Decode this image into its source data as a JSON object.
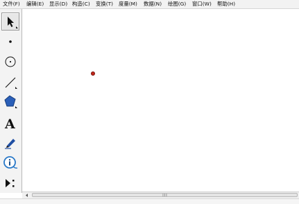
{
  "menubar": {
    "items": [
      {
        "label": "文件(F)"
      },
      {
        "label": "编辑(E)"
      },
      {
        "label": "显示(D)"
      },
      {
        "label": "构造(C)"
      },
      {
        "label": "变换(T)"
      },
      {
        "label": "度量(M)"
      },
      {
        "label": "数据(N)"
      },
      {
        "label": "绘图(G)"
      },
      {
        "label": "窗口(W)"
      },
      {
        "label": "帮助(H)"
      }
    ]
  },
  "toolbar": {
    "tools": [
      {
        "name": "arrow-select",
        "icon": "arrow-select-icon",
        "selected": true
      },
      {
        "name": "point",
        "icon": "point-icon",
        "selected": false
      },
      {
        "name": "compass",
        "icon": "compass-circle-icon",
        "selected": false
      },
      {
        "name": "straightedge",
        "icon": "line-segment-icon",
        "selected": false
      },
      {
        "name": "polygon",
        "icon": "polygon-icon",
        "selected": false
      },
      {
        "name": "text",
        "icon": "text-icon",
        "glyph": "A",
        "selected": false
      },
      {
        "name": "marker",
        "icon": "marker-pen-icon",
        "selected": false
      },
      {
        "name": "information",
        "icon": "information-icon",
        "selected": false
      },
      {
        "name": "custom-tools",
        "icon": "custom-tool-icon",
        "selected": false
      }
    ]
  },
  "canvas": {
    "points": [
      {
        "name": "point-1",
        "color": "#c0261a"
      }
    ]
  },
  "colors": {
    "menubar_bg": "#f2f2f2",
    "toolbar_bg": "#f3f3f3",
    "polygon_fill": "#2a5fb8",
    "marker_blue": "#1f4fa3",
    "info_blue": "#2878c8"
  }
}
